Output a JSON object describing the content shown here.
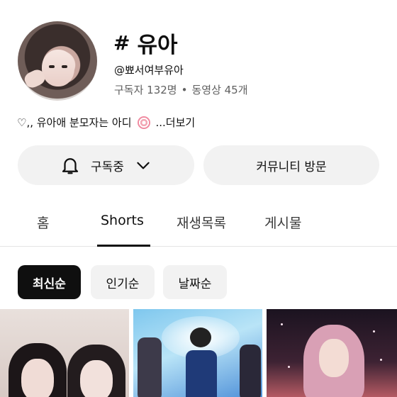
{
  "channel": {
    "name": "유아",
    "handle": "@뾰서여부유아",
    "subscribers": "구독자 132명",
    "separator": "•",
    "videos": "동영상 45개",
    "description_prefix": "♡,, 유아애 분모자는 아디",
    "more_label": "...더보기"
  },
  "actions": {
    "subscribed_label": "구독중",
    "community_label": "커뮤니티 방문"
  },
  "tabs": [
    {
      "label": "홈",
      "active": false
    },
    {
      "label": "Shorts",
      "active": true
    },
    {
      "label": "재생목록",
      "active": false
    },
    {
      "label": "게시물",
      "active": false
    }
  ],
  "sort_chips": [
    {
      "label": "최신순",
      "active": true
    },
    {
      "label": "인기순",
      "active": false
    },
    {
      "label": "날짜순",
      "active": false
    }
  ],
  "icons": {
    "title_icon": "hash-icon",
    "bell": "bell-icon",
    "chevron": "chevron-down-icon",
    "description_emoji": "candy-icon"
  },
  "colors": {
    "chip_active_bg": "#0f0f0f",
    "chip_bg": "#f2f2f2",
    "button_bg": "#f2f2f2",
    "secondary_text": "#606060"
  }
}
